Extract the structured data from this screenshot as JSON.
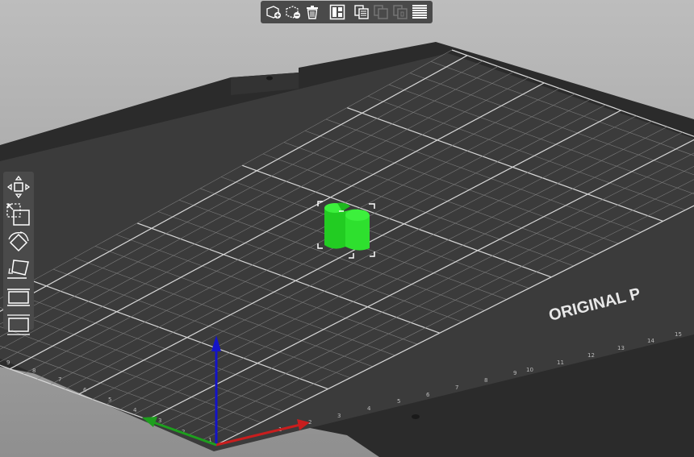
{
  "bed": {
    "label": "ORIGINAL P",
    "x_tick_labels": [
      "1",
      "2",
      "3",
      "4",
      "5",
      "6",
      "7",
      "8",
      "9",
      "10",
      "11",
      "12",
      "13",
      "14",
      "15"
    ],
    "y_tick_labels": [
      "1",
      "2",
      "3",
      "4",
      "5",
      "6",
      "7",
      "8",
      "9"
    ]
  },
  "colors": {
    "background": "#a9a9a9",
    "bed": "#2e2e2e",
    "bed_surface": "#3a3a3a",
    "grid": "#8a8a8a",
    "model": "#22dd22",
    "axis_x": "#c81e1e",
    "axis_y": "#1e9e1e",
    "axis_z": "#1414c8",
    "toolbar": "#4a4a4a"
  },
  "top_toolbar": {
    "buttons": [
      {
        "name": "add-icon",
        "enabled": true
      },
      {
        "name": "delete-icon",
        "enabled": true
      },
      {
        "name": "delete-all-icon",
        "enabled": true
      },
      {
        "name": "arrange-icon",
        "enabled": true
      },
      {
        "name": "copy-icon",
        "enabled": true
      },
      {
        "name": "paste-icon",
        "enabled": false
      },
      {
        "name": "instance-icon",
        "enabled": false
      },
      {
        "name": "layers-icon",
        "enabled": true
      }
    ]
  },
  "left_toolbar": {
    "buttons": [
      {
        "name": "move-icon"
      },
      {
        "name": "scale-icon"
      },
      {
        "name": "rotate-icon"
      },
      {
        "name": "place-on-face-icon"
      },
      {
        "name": "cut-icon"
      },
      {
        "name": "support-paint-icon"
      }
    ]
  },
  "scene": {
    "object": {
      "name": "green-object",
      "selected": true
    }
  }
}
